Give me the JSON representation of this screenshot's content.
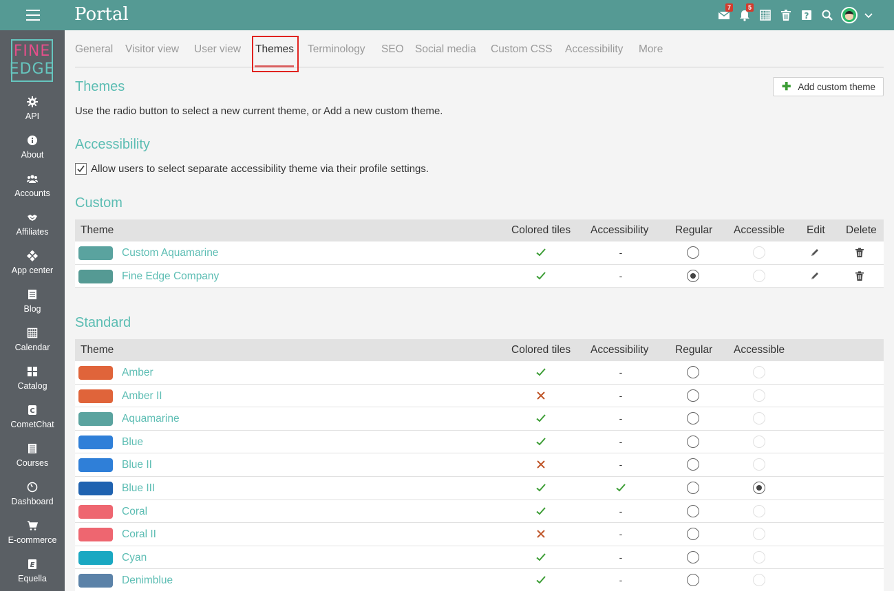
{
  "app": {
    "title": "Portal"
  },
  "topbar": {
    "icons": [
      {
        "name": "mail-icon",
        "badge": "7"
      },
      {
        "name": "bell-icon",
        "badge": "5"
      },
      {
        "name": "calendar-grid-icon"
      },
      {
        "name": "trash-icon"
      },
      {
        "name": "help-icon"
      },
      {
        "name": "search-icon"
      },
      {
        "name": "avatar"
      },
      {
        "name": "chevron-down-icon"
      }
    ]
  },
  "logo": {
    "line1": "FINE",
    "line2": "EDGE"
  },
  "sidebar": {
    "items": [
      {
        "label": "API",
        "icon": "gear-icon"
      },
      {
        "label": "About",
        "icon": "info-icon"
      },
      {
        "label": "Accounts",
        "icon": "users-icon"
      },
      {
        "label": "Affiliates",
        "icon": "handshake-icon"
      },
      {
        "label": "App center",
        "icon": "app-center-icon"
      },
      {
        "label": "Blog",
        "icon": "blog-icon"
      },
      {
        "label": "Calendar",
        "icon": "calendar-icon"
      },
      {
        "label": "Catalog",
        "icon": "catalog-icon"
      },
      {
        "label": "CometChat",
        "icon": "cometchat-icon"
      },
      {
        "label": "Courses",
        "icon": "courses-icon"
      },
      {
        "label": "Dashboard",
        "icon": "dashboard-icon"
      },
      {
        "label": "E-commerce",
        "icon": "cart-icon"
      },
      {
        "label": "Equella",
        "icon": "equella-icon"
      }
    ]
  },
  "tabs": [
    {
      "label": "General"
    },
    {
      "label": "Visitor view"
    },
    {
      "label": "User view"
    },
    {
      "label": "Themes",
      "active": true
    },
    {
      "label": "Terminology"
    },
    {
      "label": "SEO"
    },
    {
      "label": "Social media"
    },
    {
      "label": "Custom CSS"
    },
    {
      "label": "Accessibility"
    },
    {
      "label": "More"
    }
  ],
  "themes_section": {
    "title": "Themes",
    "description": "Use the radio button to select a new current theme, or Add a new custom theme.",
    "add_button": "Add custom theme"
  },
  "accessibility_section": {
    "title": "Accessibility",
    "checkbox_label": "Allow users to select separate accessibility theme via their profile settings.",
    "checked": true
  },
  "custom_section": {
    "title": "Custom",
    "headers": {
      "theme": "Theme",
      "colored_tiles": "Colored tiles",
      "accessibility": "Accessibility",
      "regular": "Regular",
      "accessible": "Accessible",
      "edit": "Edit",
      "delete": "Delete"
    },
    "rows": [
      {
        "name": "Custom Aquamarine",
        "color": "#5aa39f",
        "colored_tiles": true,
        "accessibility": "-",
        "regular_selected": false,
        "accessible_selected": false,
        "accessible_enabled": false
      },
      {
        "name": "Fine Edge Company",
        "color": "#559a94",
        "colored_tiles": true,
        "accessibility": "-",
        "regular_selected": true,
        "accessible_selected": false,
        "accessible_enabled": false
      }
    ]
  },
  "standard_section": {
    "title": "Standard",
    "headers": {
      "theme": "Theme",
      "colored_tiles": "Colored tiles",
      "accessibility": "Accessibility",
      "regular": "Regular",
      "accessible": "Accessible"
    },
    "rows": [
      {
        "name": "Amber",
        "color": "#e0643a",
        "colored_tiles": true,
        "accessibility": "-",
        "regular_selected": false,
        "accessible_selected": false,
        "accessible_enabled": false
      },
      {
        "name": "Amber II",
        "color": "#e0643a",
        "colored_tiles": false,
        "accessibility": "-",
        "regular_selected": false,
        "accessible_selected": false,
        "accessible_enabled": false
      },
      {
        "name": "Aquamarine",
        "color": "#5aa39f",
        "colored_tiles": true,
        "accessibility": "-",
        "regular_selected": false,
        "accessible_selected": false,
        "accessible_enabled": false
      },
      {
        "name": "Blue",
        "color": "#2f7fd8",
        "colored_tiles": true,
        "accessibility": "-",
        "regular_selected": false,
        "accessible_selected": false,
        "accessible_enabled": false
      },
      {
        "name": "Blue II",
        "color": "#2f7fd8",
        "colored_tiles": false,
        "accessibility": "-",
        "regular_selected": false,
        "accessible_selected": false,
        "accessible_enabled": false
      },
      {
        "name": "Blue III",
        "color": "#1f62b0",
        "colored_tiles": true,
        "accessibility": "check",
        "regular_selected": false,
        "accessible_selected": true,
        "accessible_enabled": true
      },
      {
        "name": "Coral",
        "color": "#ee6670",
        "colored_tiles": true,
        "accessibility": "-",
        "regular_selected": false,
        "accessible_selected": false,
        "accessible_enabled": false
      },
      {
        "name": "Coral II",
        "color": "#ee6670",
        "colored_tiles": false,
        "accessibility": "-",
        "regular_selected": false,
        "accessible_selected": false,
        "accessible_enabled": false
      },
      {
        "name": "Cyan",
        "color": "#1aa8c2",
        "colored_tiles": true,
        "accessibility": "-",
        "regular_selected": false,
        "accessible_selected": false,
        "accessible_enabled": false
      },
      {
        "name": "Denimblue",
        "color": "#5b82a8",
        "colored_tiles": true,
        "accessibility": "-",
        "regular_selected": false,
        "accessible_selected": false,
        "accessible_enabled": false
      }
    ]
  },
  "colors": {
    "accent": "#5cbdb3",
    "topbar": "#559a94",
    "sidebar": "#5a5f64",
    "check": "#3c9d35",
    "cross": "#c0562a"
  }
}
